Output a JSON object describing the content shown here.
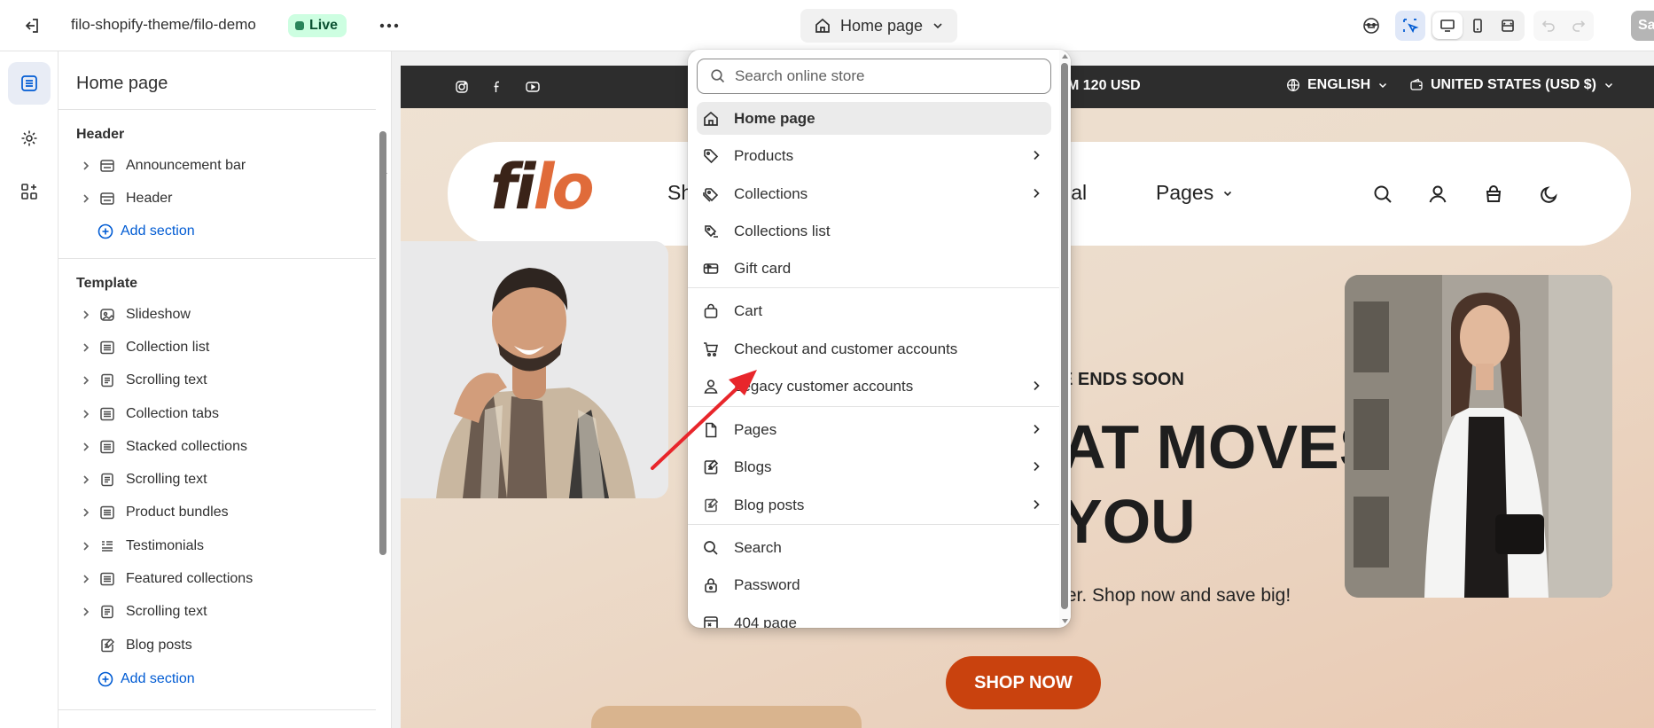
{
  "topbar": {
    "store_name": "filo-shopify-theme/filo-demo",
    "status_badge": "Live",
    "more_label": "•••",
    "page_selector": "Home page",
    "save_label": "Sa"
  },
  "sidebar": {
    "title": "Home page",
    "header_group": "Header",
    "header_items": [
      {
        "label": "Announcement bar",
        "icon": "announcement-bar-icon"
      },
      {
        "label": "Header",
        "icon": "header-icon"
      }
    ],
    "add_section": "Add section",
    "template_group": "Template",
    "template_items": [
      {
        "label": "Slideshow",
        "icon": "slideshow-icon"
      },
      {
        "label": "Collection list",
        "icon": "collection-list-icon"
      },
      {
        "label": "Scrolling text",
        "icon": "text-icon"
      },
      {
        "label": "Collection tabs",
        "icon": "collection-list-icon"
      },
      {
        "label": "Stacked collections",
        "icon": "collection-list-icon"
      },
      {
        "label": "Scrolling text",
        "icon": "text-icon"
      },
      {
        "label": "Product bundles",
        "icon": "collection-list-icon"
      },
      {
        "label": "Testimonials",
        "icon": "testimonials-icon"
      },
      {
        "label": "Featured collections",
        "icon": "collection-list-icon"
      },
      {
        "label": "Scrolling text",
        "icon": "text-icon"
      },
      {
        "label": "Blog posts",
        "icon": "blog-post-icon"
      }
    ],
    "add_section_2": "Add section"
  },
  "preview": {
    "promo_text": "M 120 USD",
    "language": "ENGLISH",
    "currency": "UNITED STATES (USD $)",
    "logo_a": "fi",
    "logo_b": "lo",
    "nav_shop": "Sh",
    "nav_journal": "urnal",
    "nav_pages": "Pages",
    "ends_soon": "E ENDS SOON",
    "headline_1": "AT MOVES",
    "headline_2": "YOU",
    "subtext": "fer. Shop now and save big!",
    "cta": "SHOP NOW"
  },
  "dropdown": {
    "search_placeholder": "Search online store",
    "items": [
      {
        "label": "Home page",
        "icon": "home-icon",
        "submenu": false,
        "selected": true
      },
      {
        "label": "Products",
        "icon": "tag-icon",
        "submenu": true
      },
      {
        "label": "Collections",
        "icon": "collections-icon",
        "submenu": true
      },
      {
        "label": "Collections list",
        "icon": "collections-list-icon",
        "submenu": false
      },
      {
        "label": "Gift card",
        "icon": "gift-card-icon",
        "submenu": false
      },
      {
        "label": "Cart",
        "icon": "bag-icon",
        "submenu": false
      },
      {
        "label": "Checkout and customer accounts",
        "icon": "cart-icon",
        "submenu": false
      },
      {
        "label": "Legacy customer accounts",
        "icon": "person-icon",
        "submenu": true
      },
      {
        "label": "Pages",
        "icon": "page-icon",
        "submenu": true
      },
      {
        "label": "Blogs",
        "icon": "blog-icon",
        "submenu": true
      },
      {
        "label": "Blog posts",
        "icon": "blog-post-icon",
        "submenu": true
      },
      {
        "label": "Search",
        "icon": "search-icon",
        "submenu": false
      },
      {
        "label": "Password",
        "icon": "lock-icon",
        "submenu": false
      },
      {
        "label": "404 page",
        "icon": "error-page-icon",
        "submenu": false
      }
    ]
  },
  "colors": {
    "accent_blue": "#005bd3",
    "live_bg": "#cdfee1",
    "cta": "#c9420e",
    "annotation_arrow": "#e8262b"
  }
}
